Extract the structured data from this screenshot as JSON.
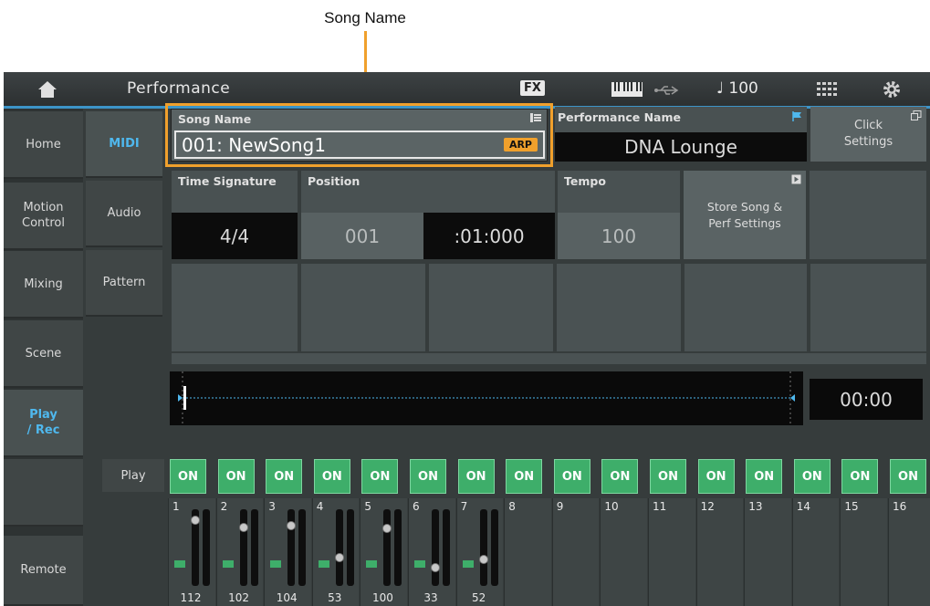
{
  "annotation": {
    "label": "Song Name"
  },
  "topbar": {
    "title": "Performance",
    "fx": "FX",
    "tempo": "♩ 100"
  },
  "left_nav": [
    "Home",
    "Motion Control",
    "Mixing",
    "Scene",
    "Play / Rec",
    "",
    "Remote"
  ],
  "sub_nav": [
    "MIDI",
    "Audio",
    "Pattern"
  ],
  "song": {
    "label": "Song Name",
    "value": "001: NewSong1",
    "arp": "ARP"
  },
  "performance": {
    "label": "Performance Name",
    "value": "DNA Lounge"
  },
  "click": {
    "label": "Click Settings"
  },
  "time_signature": {
    "label": "Time Signature",
    "value": "4/4"
  },
  "position": {
    "label": "Position",
    "measure": "001",
    "beat": ":01:000"
  },
  "tempo": {
    "label": "Tempo",
    "value": "100"
  },
  "store": {
    "label": "Store Song & Perf Settings"
  },
  "time_display": "00:00",
  "play_row": {
    "label": "Play",
    "buttons": [
      "ON",
      "ON",
      "ON",
      "ON",
      "ON",
      "ON",
      "ON",
      "ON",
      "ON",
      "ON",
      "ON",
      "ON",
      "ON",
      "ON",
      "ON",
      "ON"
    ]
  },
  "tracks": [
    {
      "num": "1",
      "value": "112",
      "fader": 0.9,
      "active": true
    },
    {
      "num": "2",
      "value": "102",
      "fader": 0.8,
      "active": true
    },
    {
      "num": "3",
      "value": "104",
      "fader": 0.82,
      "active": true
    },
    {
      "num": "4",
      "value": "53",
      "fader": 0.35,
      "active": true
    },
    {
      "num": "5",
      "value": "100",
      "fader": 0.78,
      "active": true
    },
    {
      "num": "6",
      "value": "33",
      "fader": 0.2,
      "active": true
    },
    {
      "num": "7",
      "value": "52",
      "fader": 0.33,
      "active": true
    },
    {
      "num": "8",
      "value": "",
      "fader": 0,
      "active": false
    },
    {
      "num": "9",
      "value": "",
      "fader": 0,
      "active": false
    },
    {
      "num": "10",
      "value": "",
      "fader": 0,
      "active": false
    },
    {
      "num": "11",
      "value": "",
      "fader": 0,
      "active": false
    },
    {
      "num": "12",
      "value": "",
      "fader": 0,
      "active": false
    },
    {
      "num": "13",
      "value": "",
      "fader": 0,
      "active": false
    },
    {
      "num": "14",
      "value": "",
      "fader": 0,
      "active": false
    },
    {
      "num": "15",
      "value": "",
      "fader": 0,
      "active": false
    },
    {
      "num": "16",
      "value": "",
      "fader": 0,
      "active": false
    }
  ],
  "colors": {
    "accent": "#3c94c8",
    "highlight": "#f0a02c",
    "on_green": "#3eae6a",
    "active_text": "#4fb8ee"
  }
}
